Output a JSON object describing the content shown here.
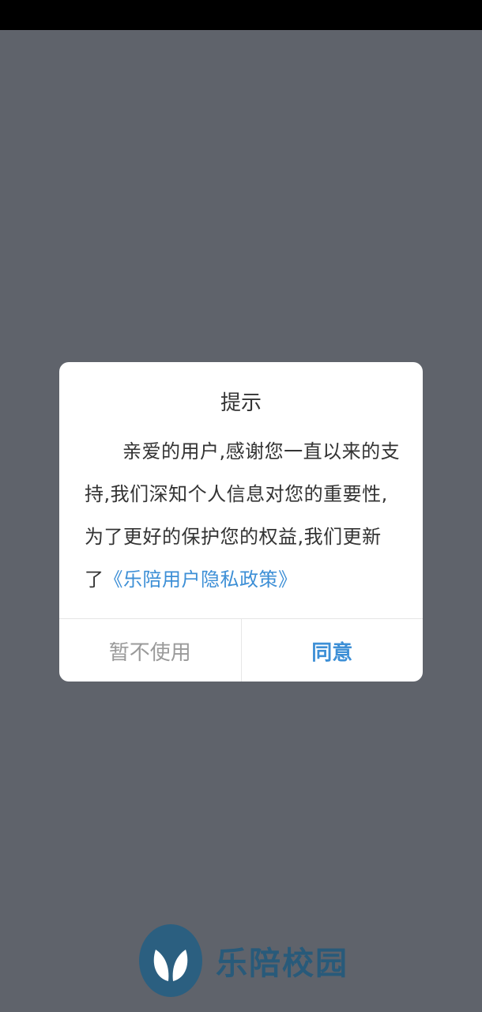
{
  "dialog": {
    "title": "提示",
    "body_prefix": "亲爱的用户,感谢您一直以来的支持,我们深知个人信息对您的重要性,为了更好的保护您的权益,我们更新了",
    "policy_link": "《乐陪用户隐私政策》",
    "cancel_label": "暂不使用",
    "agree_label": "同意"
  },
  "brand": {
    "name": "乐陪校园",
    "icon": "leaf-logo-icon"
  },
  "colors": {
    "background": "#5f636b",
    "status_bar": "#000000",
    "link": "#3d8fd6",
    "agree": "#3d8fd6",
    "cancel": "#9a9a9a",
    "brand": "#285a7a"
  }
}
